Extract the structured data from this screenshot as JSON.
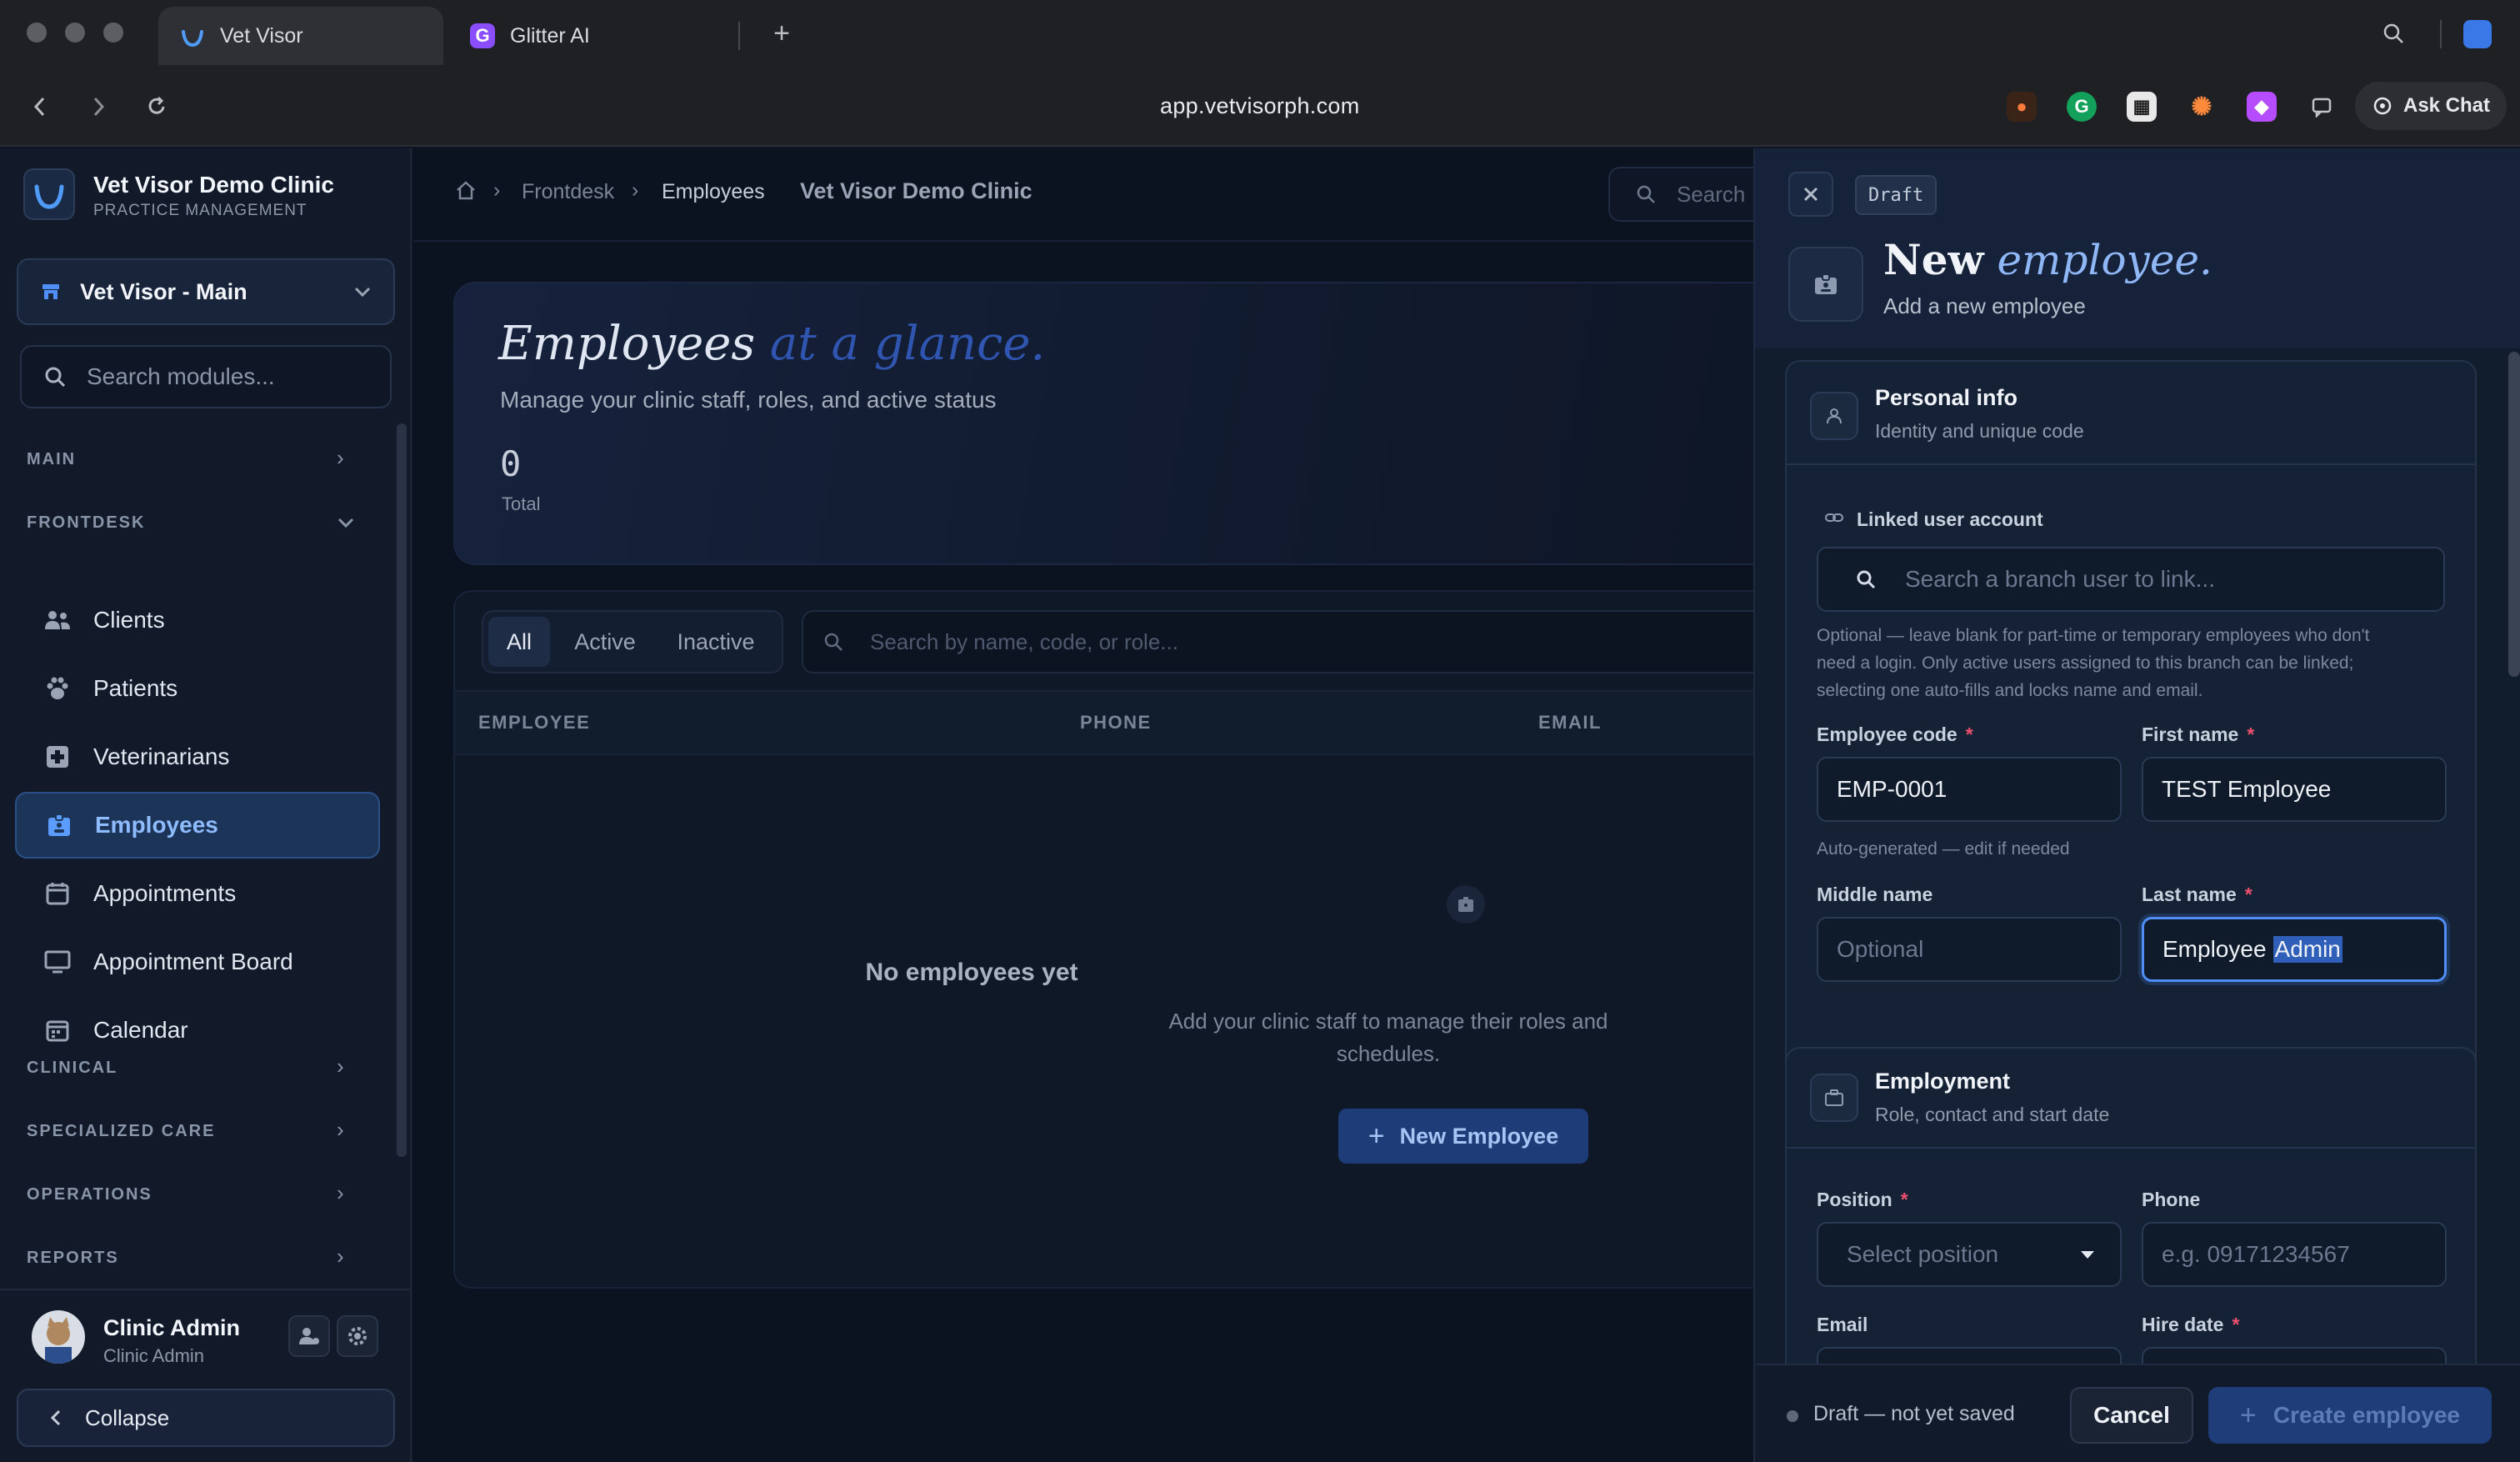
{
  "browser": {
    "tabs": [
      {
        "label": "Vet Visor"
      },
      {
        "label": "Glitter AI"
      }
    ],
    "url": "app.vetvisorph.com",
    "ask_chat": "Ask Chat"
  },
  "sidebar": {
    "clinic_name": "Vet Visor Demo Clinic",
    "clinic_subtitle": "PRACTICE MANAGEMENT",
    "branch": "Vet Visor - Main",
    "search_placeholder": "Search modules...",
    "sections": {
      "main": "MAIN",
      "frontdesk": "FRONTDESK",
      "clinical": "CLINICAL",
      "specialized": "SPECIALIZED CARE",
      "operations": "OPERATIONS",
      "reports": "REPORTS"
    },
    "items": [
      {
        "label": "Clients",
        "icon": "users-icon"
      },
      {
        "label": "Patients",
        "icon": "paw-icon"
      },
      {
        "label": "Veterinarians",
        "icon": "medical-cross-icon"
      },
      {
        "label": "Employees",
        "icon": "id-badge-icon",
        "active": true
      },
      {
        "label": "Appointments",
        "icon": "calendar-check-icon"
      },
      {
        "label": "Appointment Board",
        "icon": "monitor-icon"
      },
      {
        "label": "Calendar",
        "icon": "calendar-icon"
      }
    ],
    "user": {
      "name": "Clinic Admin",
      "role": "Clinic Admin"
    },
    "collapse": "Collapse"
  },
  "main": {
    "breadcrumb": [
      "Frontdesk",
      "Employees"
    ],
    "clinic_label": "Vet Visor Demo Clinic",
    "search_placeholder": "Search",
    "hero": {
      "title_a": "Employees",
      "title_b": "at a glance.",
      "subtitle": "Manage your clinic staff, roles, and active status",
      "count": "0",
      "count_label": "Total"
    },
    "filters": [
      "All",
      "Active",
      "Inactive"
    ],
    "table_search_placeholder": "Search by name, code, or role...",
    "columns": [
      "EMPLOYEE",
      "PHONE",
      "EMAIL"
    ],
    "empty": {
      "title": "No employees yet",
      "text_line1": "Add your clinic staff to manage their roles and",
      "text_line2": "schedules.",
      "button": "New Employee"
    }
  },
  "drawer": {
    "badge": "Draft",
    "title_a": "New",
    "title_b": "employee.",
    "subtitle": "Add a new employee",
    "personal": {
      "title": "Personal info",
      "subtitle": "Identity and unique code",
      "linked_label": "Linked user account",
      "linked_placeholder": "Search a branch user to link...",
      "linked_hint_1": "Optional — leave blank for part-time or temporary employees who don't",
      "linked_hint_2": "need a login. Only active users assigned to this branch can be linked;",
      "linked_hint_3": "selecting one auto-fills and locks name and email.",
      "code_label": "Employee code",
      "code_value": "EMP-0001",
      "code_hint": "Auto-generated — edit if needed",
      "first_label": "First name",
      "first_value": "TEST Employee",
      "middle_label": "Middle name",
      "middle_placeholder": "Optional",
      "last_label": "Last name",
      "last_value_a": "Employee",
      "last_value_b": "Admin"
    },
    "employment": {
      "title": "Employment",
      "subtitle": "Role, contact and start date",
      "position_label": "Position",
      "position_placeholder": "Select position",
      "phone_label": "Phone",
      "phone_placeholder": "e.g. 09171234567",
      "email_label": "Email",
      "hire_label": "Hire date"
    },
    "footer": {
      "status": "Draft — not yet saved",
      "cancel": "Cancel",
      "create": "Create employee"
    }
  },
  "colors": {
    "accent": "#4f8ef7",
    "sidebar_bg": "#121a2a",
    "drawer_bg": "#111c2d",
    "required": "#f0506e"
  }
}
